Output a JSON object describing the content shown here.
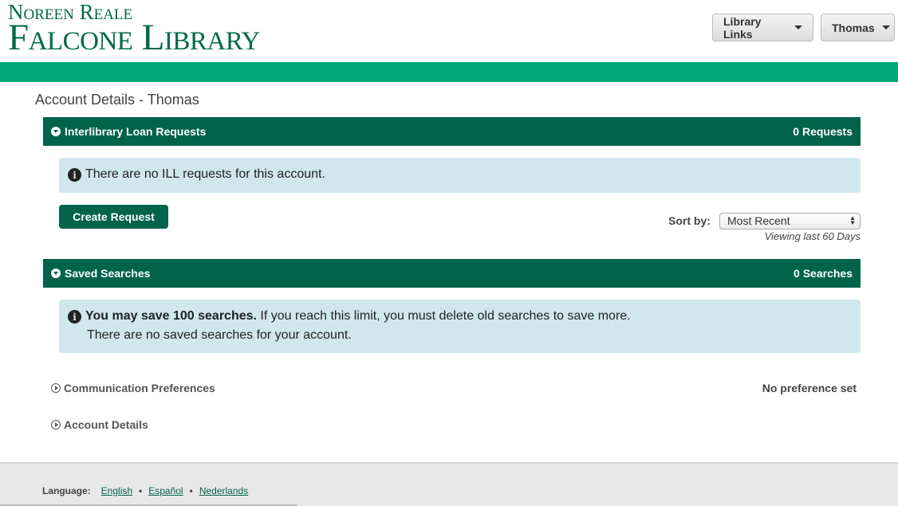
{
  "brand": {
    "line1": "Noreen Reale",
    "line2": "Falcone Library",
    "color": "#00694a"
  },
  "header": {
    "library_links": "Library Links",
    "user_menu": "Thomas"
  },
  "colors": {
    "accent_bar": "#00a878",
    "panel": "#00634a",
    "alert_bg": "#d0e7ee"
  },
  "page": {
    "title": "Account Details - Thomas"
  },
  "ill": {
    "heading": "Interlibrary Loan Requests",
    "count": "0 Requests",
    "alert": "There are no ILL requests for this account.",
    "create_label": "Create Request",
    "sort_label": "Sort by:",
    "sort_value": "Most Recent",
    "viewing": "Viewing last 60 Days"
  },
  "saved": {
    "heading": "Saved Searches",
    "count": "0 Searches",
    "alert_bold": "You may save 100 searches.",
    "alert_rest": " If you reach this limit, you must delete old searches to save more.",
    "alert_line2": "There are no saved searches for your account."
  },
  "comm": {
    "label": "Communication Preferences",
    "value": "No preference set"
  },
  "account": {
    "label": "Account Details"
  },
  "footer": {
    "language_label": "Language:",
    "languages": [
      "English",
      "Español",
      "Nederlands"
    ]
  }
}
